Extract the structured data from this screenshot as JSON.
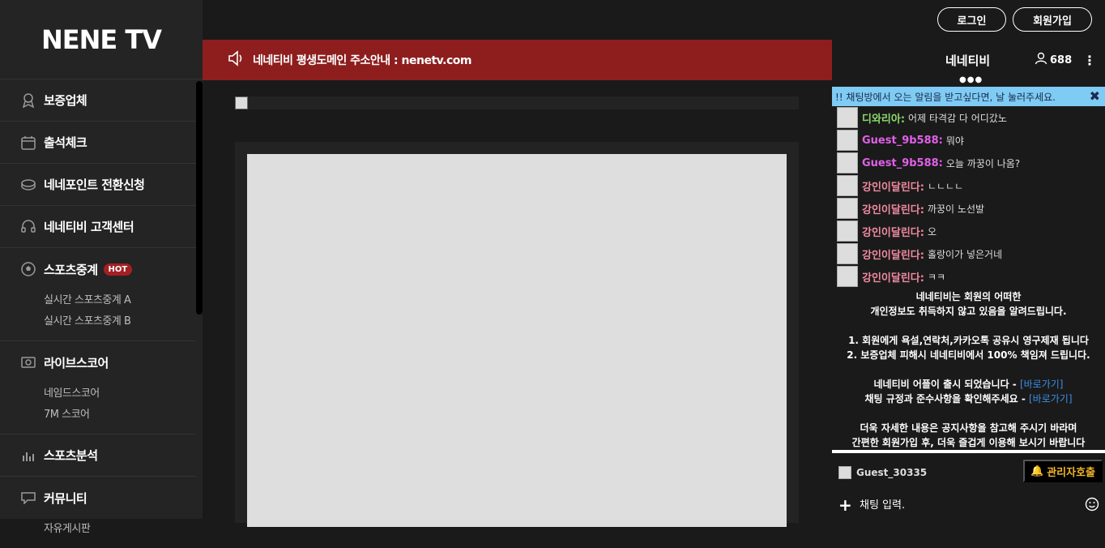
{
  "brand": {
    "logo": "NENE TV"
  },
  "sidebar": {
    "items": [
      {
        "label": "보증업체",
        "icon": "medal-icon"
      },
      {
        "label": "출석체크",
        "icon": "calendar-icon"
      },
      {
        "label": "네네포인트 전환신청",
        "icon": "coin-icon"
      },
      {
        "label": "네네티비 고객센터",
        "icon": "headset-icon"
      }
    ],
    "groups": [
      {
        "label": "스포츠중계",
        "icon": "soccer-ball-icon",
        "badge": "HOT",
        "subs": [
          "실시간 스포츠중계 A",
          "실시간 스포츠중계 B"
        ]
      },
      {
        "label": "라이브스코어",
        "icon": "scoreboard-icon",
        "subs": [
          "네임드스코어",
          "7M 스코어"
        ]
      },
      {
        "label": "스포츠분석",
        "icon": "bar-chart-icon",
        "subs": []
      },
      {
        "label": "커뮤니티",
        "icon": "chat-bubble-icon",
        "subs": [
          "자유게시판"
        ]
      }
    ]
  },
  "header": {
    "login_label": "로그인",
    "signup_label": "회원가입"
  },
  "notice": {
    "text": "네네티비 평생도메인 주소안내 : nenetv.com"
  },
  "chat": {
    "title": "네네티비",
    "viewers": "688",
    "alert": "!! 채팅방에서 오는 알림을 받고싶다면, 날 눌러주세요.",
    "messages": [
      {
        "nick": "디와리아:",
        "text": "어제 타격감 다 어디갔노",
        "color": "#8bd86a"
      },
      {
        "nick": "Guest_9b588:",
        "text": "뭐야",
        "color": "#e060e8"
      },
      {
        "nick": "Guest_9b588:",
        "text": "오늘 까꿍이 나옴?",
        "color": "#e060e8"
      },
      {
        "nick": "강인이달린다:",
        "text": "ㄴㄴㄴㄴ",
        "color": "#f08aa0"
      },
      {
        "nick": "강인이달린다:",
        "text": "까꿍이 노선발",
        "color": "#f08aa0"
      },
      {
        "nick": "강인이달린다:",
        "text": "오",
        "color": "#f08aa0"
      },
      {
        "nick": "강인이달린다:",
        "text": "홀랑이가 넣은거네",
        "color": "#f08aa0"
      },
      {
        "nick": "강인이달린다:",
        "text": "ㅋㅋ",
        "color": "#f08aa0"
      }
    ],
    "rules": {
      "l1": "네네티비는 회원의 어떠한",
      "l2": "개인정보도 취득하지 않고 있음을 알려드립니다.",
      "l3": "1. 회원에게 욕설,연락처,카카오톡 공유시 영구제재 됩니다",
      "l4": "2. 보증업체 피해시 네네티비에서 100% 책임져 드립니다.",
      "l5": "네네티비 어플이 출시 되었습니다 - ",
      "l5_link": "[바로가기]",
      "l6": "채팅 규정과 준수사항을 확인해주세요 - ",
      "l6_link": "[바로가기]",
      "l7": "더욱 자세한 내용은 공지사항을 참고해 주시기 바라며",
      "l8": "간편한 회원가입 후, 더욱 즐겁게 이용해 보시기 바랍니다"
    },
    "me": "Guest_30335",
    "admin_label": "관리자호출",
    "input_placeholder": "채팅 입력."
  }
}
